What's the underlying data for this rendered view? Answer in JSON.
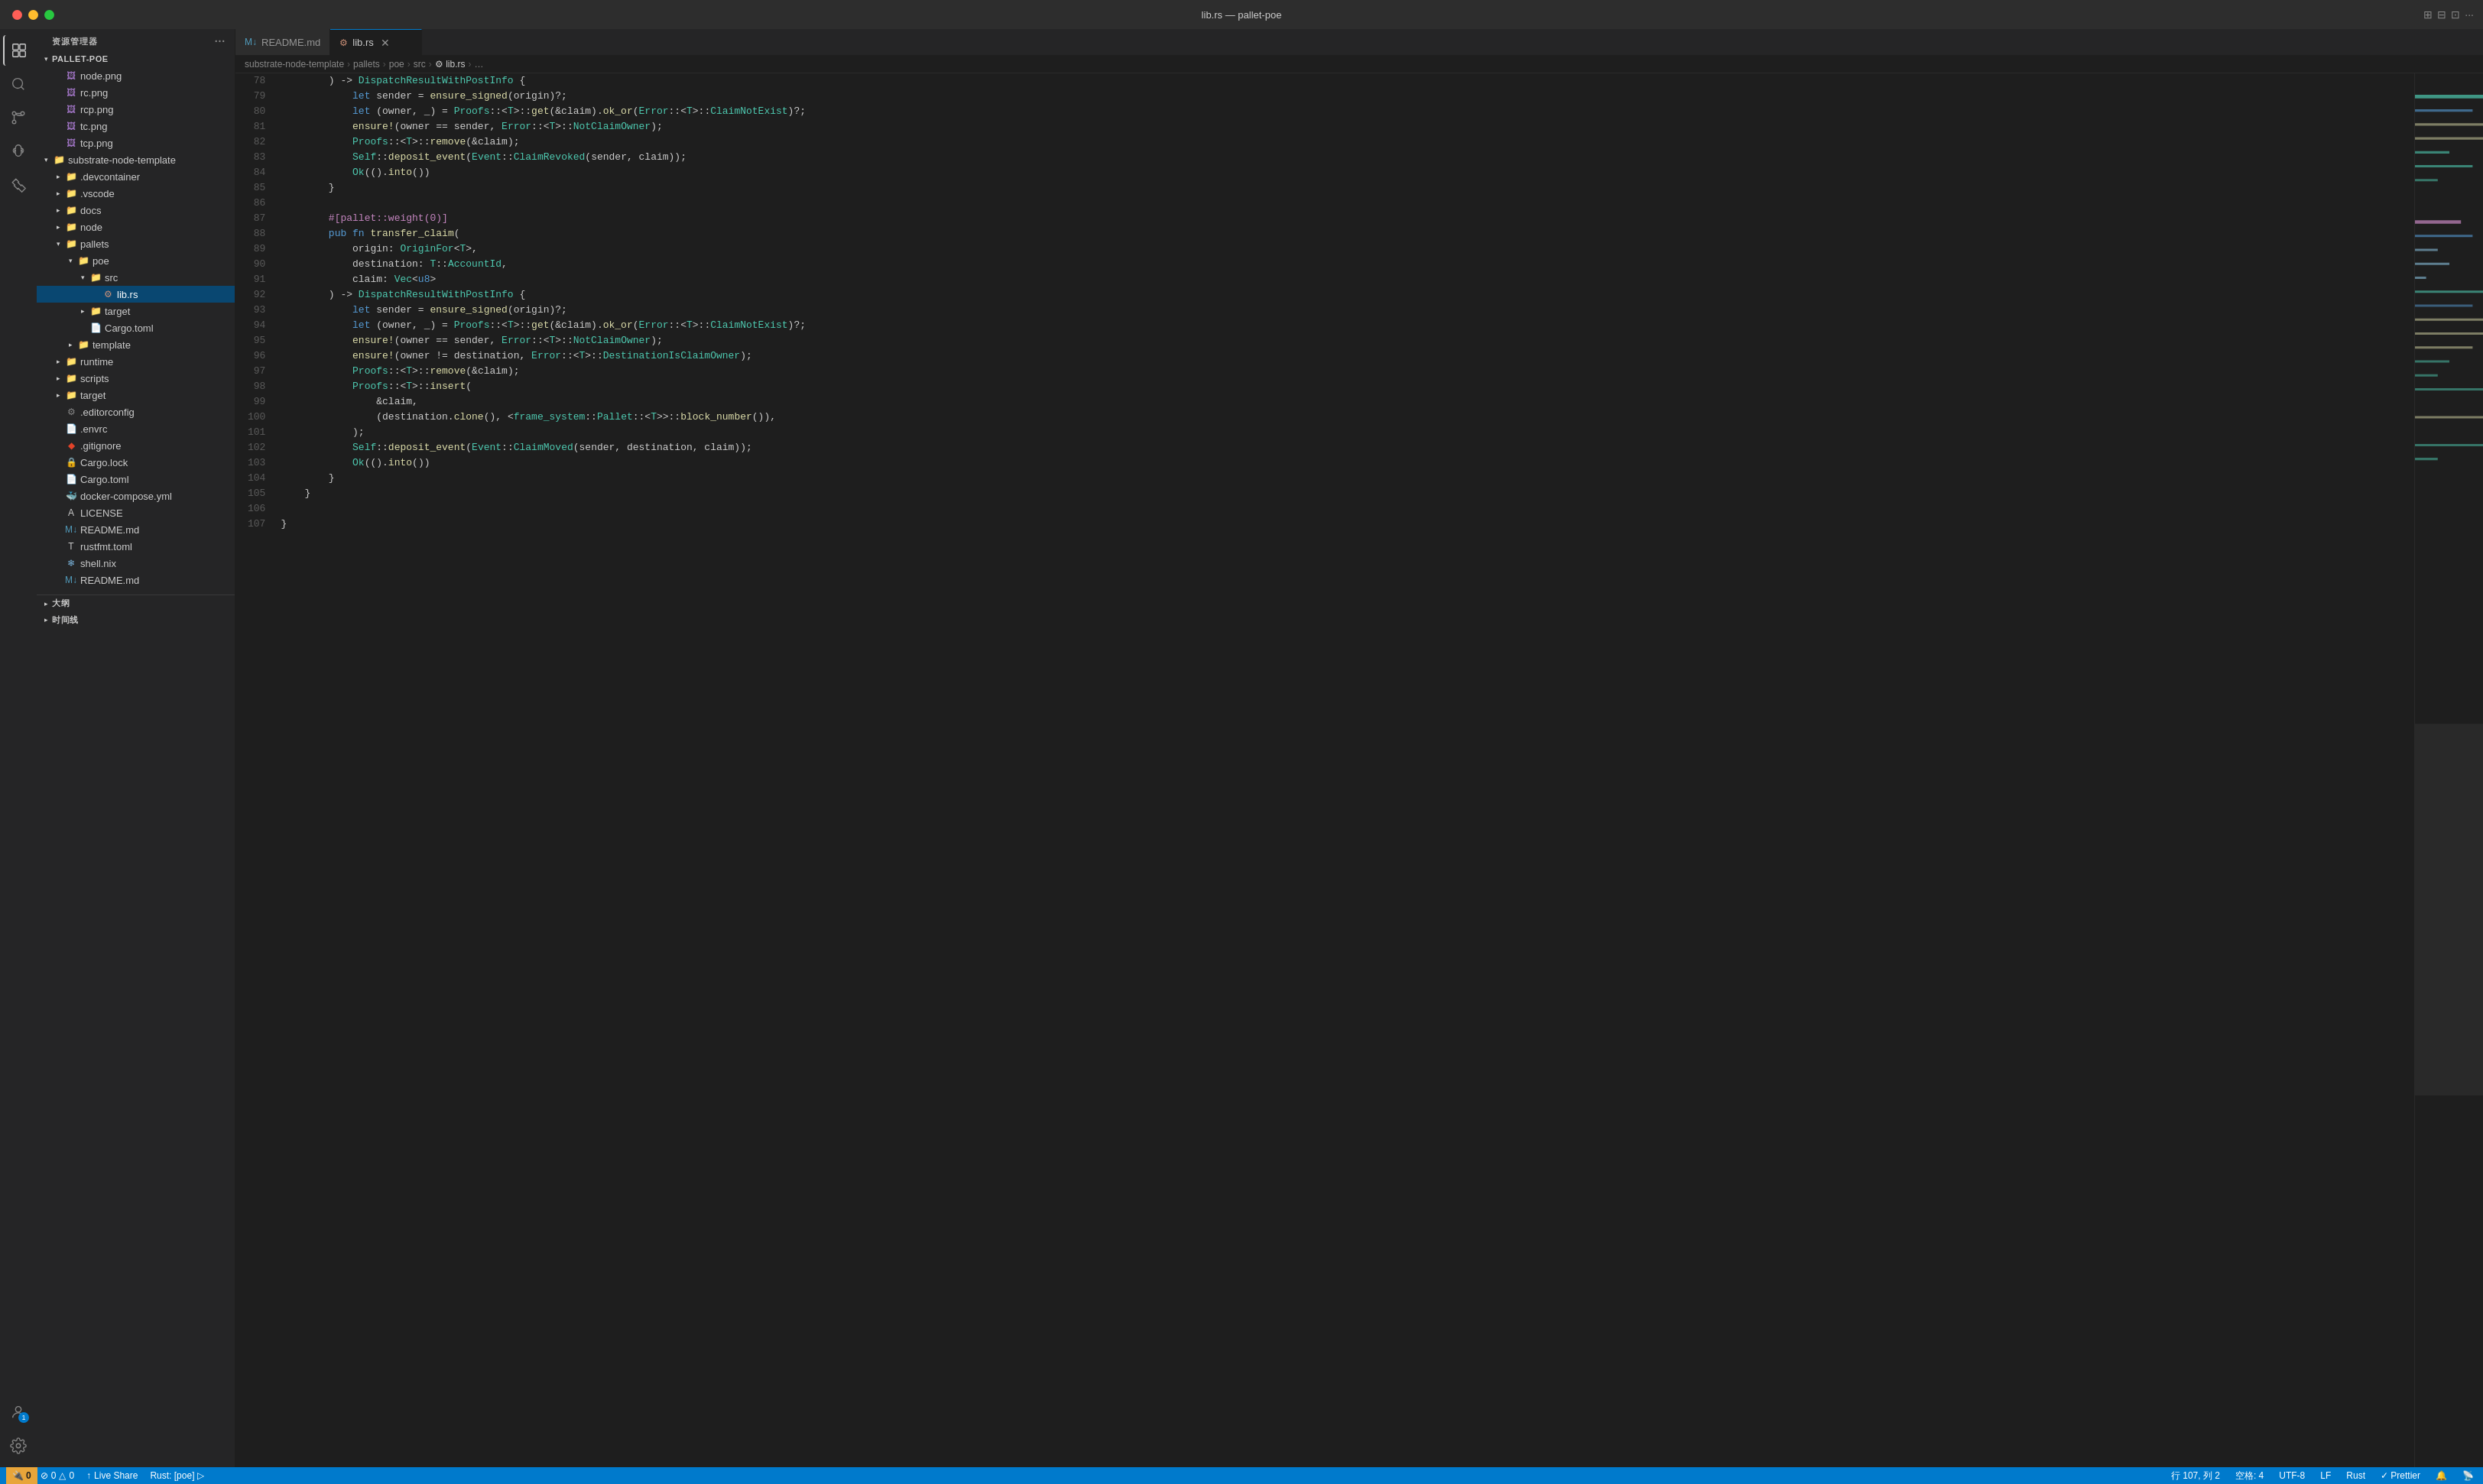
{
  "titlebar": {
    "title": "lib.rs — pallet-poe",
    "buttons": {
      "close_label": "close",
      "minimize_label": "minimize",
      "maximize_label": "maximize"
    }
  },
  "sidebar": {
    "header": "资源管理器",
    "root": "PALLET-POE",
    "items": [
      {
        "id": "node-png",
        "label": "node.png",
        "type": "file-png",
        "depth": 1
      },
      {
        "id": "rc-png",
        "label": "rc.png",
        "type": "file-png",
        "depth": 1
      },
      {
        "id": "rcp-png",
        "label": "rcp.png",
        "type": "file-png",
        "depth": 1
      },
      {
        "id": "tc-png",
        "label": "tc.png",
        "type": "file-png",
        "depth": 1
      },
      {
        "id": "tcp-png",
        "label": "tcp.png",
        "type": "file-png",
        "depth": 1
      },
      {
        "id": "substrate-node-template",
        "label": "substrate-node-template",
        "type": "folder-open",
        "depth": 1
      },
      {
        "id": "devcontainer",
        "label": ".devcontainer",
        "type": "folder",
        "depth": 2
      },
      {
        "id": "vscode",
        "label": ".vscode",
        "type": "folder",
        "depth": 2
      },
      {
        "id": "docs",
        "label": "docs",
        "type": "folder",
        "depth": 2
      },
      {
        "id": "node",
        "label": "node",
        "type": "folder",
        "depth": 2
      },
      {
        "id": "pallets",
        "label": "pallets",
        "type": "folder-open",
        "depth": 2
      },
      {
        "id": "poe",
        "label": "poe",
        "type": "folder-open",
        "depth": 3
      },
      {
        "id": "src",
        "label": "src",
        "type": "folder-open",
        "depth": 4
      },
      {
        "id": "lib-rs",
        "label": "lib.rs",
        "type": "file-rust",
        "depth": 5,
        "selected": true
      },
      {
        "id": "target",
        "label": "target",
        "type": "folder",
        "depth": 4
      },
      {
        "id": "cargo-toml-poe",
        "label": "Cargo.toml",
        "type": "file-toml",
        "depth": 4
      },
      {
        "id": "template",
        "label": "template",
        "type": "folder",
        "depth": 3
      },
      {
        "id": "runtime",
        "label": "runtime",
        "type": "folder",
        "depth": 2
      },
      {
        "id": "scripts",
        "label": "scripts",
        "type": "folder",
        "depth": 2
      },
      {
        "id": "target2",
        "label": "target",
        "type": "folder",
        "depth": 2
      },
      {
        "id": "editorconfig",
        "label": ".editorconfig",
        "type": "file",
        "depth": 2
      },
      {
        "id": "envrc",
        "label": ".envrc",
        "type": "file-env",
        "depth": 2
      },
      {
        "id": "gitignore",
        "label": ".gitignore",
        "type": "file-git",
        "depth": 2
      },
      {
        "id": "cargo-lock",
        "label": "Cargo.lock",
        "type": "file-lock",
        "depth": 2
      },
      {
        "id": "cargo-toml",
        "label": "Cargo.toml",
        "type": "file-toml",
        "depth": 2
      },
      {
        "id": "docker-compose",
        "label": "docker-compose.yml",
        "type": "file-docker",
        "depth": 2
      },
      {
        "id": "license",
        "label": "LICENSE",
        "type": "file-license",
        "depth": 2
      },
      {
        "id": "readme-md",
        "label": "README.md",
        "type": "file-md",
        "depth": 2
      },
      {
        "id": "rustfmt-toml",
        "label": "rustfmt.toml",
        "type": "file-toml",
        "depth": 2
      },
      {
        "id": "shell-nix",
        "label": "shell.nix",
        "type": "file-nix",
        "depth": 2
      },
      {
        "id": "readme-md2",
        "label": "README.md",
        "type": "file-md",
        "depth": 1
      }
    ],
    "sections": [
      {
        "label": "大纲"
      },
      {
        "label": "时间线"
      }
    ]
  },
  "tabs": [
    {
      "id": "readme",
      "label": "README.md",
      "icon": "md",
      "active": false,
      "closable": false
    },
    {
      "id": "lib-rs",
      "label": "lib.rs",
      "icon": "rust",
      "active": true,
      "closable": true
    }
  ],
  "breadcrumb": {
    "parts": [
      "substrate-node-template",
      "pallets",
      "poe",
      "src",
      "lib.rs",
      "…"
    ]
  },
  "code": {
    "lines": [
      {
        "num": 78,
        "content": "        ) -> DispatchResultWithPostInfo {"
      },
      {
        "num": 79,
        "content": "            let sender = ensure_signed(origin)?;"
      },
      {
        "num": 80,
        "content": "            let (owner, _) = Proofs::<T>::get(&claim).ok_or(Error::<T>::ClaimNotExist)?;"
      },
      {
        "num": 81,
        "content": "            ensure!(owner == sender, Error::<T>::NotClaimOwner);"
      },
      {
        "num": 82,
        "content": "            Proofs::<T>::remove(&claim);"
      },
      {
        "num": 83,
        "content": "            Self::deposit_event(Event::ClaimRevoked(sender, claim));"
      },
      {
        "num": 84,
        "content": "            Ok(().into())"
      },
      {
        "num": 85,
        "content": "        }"
      },
      {
        "num": 86,
        "content": ""
      },
      {
        "num": 87,
        "content": "        #[pallet::weight(0)]"
      },
      {
        "num": 88,
        "content": "        pub fn transfer_claim("
      },
      {
        "num": 89,
        "content": "            origin: OriginFor<T>,"
      },
      {
        "num": 90,
        "content": "            destination: T::AccountId,"
      },
      {
        "num": 91,
        "content": "            claim: Vec<u8>"
      },
      {
        "num": 92,
        "content": "        ) -> DispatchResultWithPostInfo {"
      },
      {
        "num": 93,
        "content": "            let sender = ensure_signed(origin)?;"
      },
      {
        "num": 94,
        "content": "            let (owner, _) = Proofs::<T>::get(&claim).ok_or(Error::<T>::ClaimNotExist)?;"
      },
      {
        "num": 95,
        "content": "            ensure!(owner == sender, Error::<T>::NotClaimOwner);"
      },
      {
        "num": 96,
        "content": "            ensure!(owner != destination, Error::<T>::DestinationIsClaimOwner);"
      },
      {
        "num": 97,
        "content": "            Proofs::<T>::remove(&claim);"
      },
      {
        "num": 98,
        "content": "            Proofs::<T>::insert("
      },
      {
        "num": 99,
        "content": "                &claim,"
      },
      {
        "num": 100,
        "content": "                (destination.clone(), <frame_system::Pallet::<T>>::block_number()),"
      },
      {
        "num": 101,
        "content": "            );"
      },
      {
        "num": 102,
        "content": "            Self::deposit_event(Event::ClaimMoved(sender, destination, claim));"
      },
      {
        "num": 103,
        "content": "            Ok(().into())"
      },
      {
        "num": 104,
        "content": "        }"
      },
      {
        "num": 105,
        "content": "    }"
      },
      {
        "num": 106,
        "content": ""
      },
      {
        "num": 107,
        "content": "}"
      }
    ]
  },
  "status": {
    "wext": "🔌 0",
    "errors": "⚠ 0  △ 0",
    "live_share": "Live Share",
    "rust": "Rust: [poe]",
    "line_col": "行 107, 列 2",
    "spaces": "空格: 4",
    "encoding": "UTF-8",
    "eol": "LF",
    "lang": "Rust",
    "formatter": "✓ Prettier",
    "bell": "🔔",
    "notifications": "🔔"
  },
  "activity": {
    "items": [
      {
        "id": "explorer",
        "label": "Explorer",
        "active": true
      },
      {
        "id": "search",
        "label": "Search"
      },
      {
        "id": "git",
        "label": "Source Control"
      },
      {
        "id": "debug",
        "label": "Run and Debug"
      },
      {
        "id": "extensions",
        "label": "Extensions"
      }
    ],
    "bottom": [
      {
        "id": "accounts",
        "label": "Accounts",
        "badge": "1"
      },
      {
        "id": "settings",
        "label": "Settings"
      }
    ]
  }
}
